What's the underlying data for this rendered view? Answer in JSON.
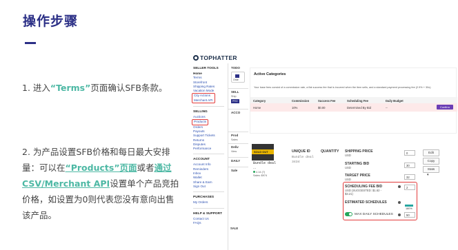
{
  "slide": {
    "title": "操作步骤",
    "step1": {
      "pre": "1. 进入",
      "highlight": "“Terms”",
      "post": "页面确认SFB条款。"
    },
    "step2": {
      "pre": "2.  为产品设置SFB价格和每日最大安排量：可以在",
      "highlight1": "“Products”页面",
      "mid": "或者",
      "highlight2": "通过CSV/Merchant API",
      "post": "设置单个产品竞拍价格，如设置为0则代表您没有意向出售该产品。"
    },
    "colors": {
      "title": "#2b2f86",
      "accent": "#4db8a4",
      "annotation": "#e23a3a"
    }
  },
  "screenshot": {
    "logo": "TOPHATTER",
    "sidebar": {
      "seller_tools_head": "SELLER TOOLS",
      "seller_tools": [
        "Home",
        "Terms",
        "Storefront",
        "Shipping Rates",
        "Vacation Mode",
        "City Actions",
        "Merchant API"
      ],
      "selling_head": "SELLING",
      "selling": [
        "Auctions",
        "Products",
        "Orders",
        "Payouts",
        "Support Tickets",
        "Returns",
        "Disputes",
        "Performance"
      ],
      "account_head": "ACCOUNT",
      "account": [
        "Account Info",
        "Reminders",
        "Inbox",
        "Wallet",
        "Share & Earn",
        "Sign Out"
      ],
      "purchases_head": "PURCHASES",
      "purchases": [
        "My Orders"
      ],
      "help_head": "HELP & SUPPORT",
      "help": [
        "Contact Us",
        "FAQs"
      ]
    },
    "todo": {
      "label": "TODO",
      "card_text": "Orde",
      "sections": [
        "SELL",
        "ACCO",
        "Prod",
        "Deliv",
        "DAILY",
        "Sale",
        "SALE"
      ],
      "small": [
        "Ship",
        "Sales",
        "View"
      ],
      "button": "PRO"
    },
    "categories": {
      "title": "Active Categories",
      "description": "Your base fees consist of a commission rate, a flat success fee that is incurred when the item sells, and a standard payment processing fee (2.9% + 30c).",
      "headers": [
        "Category",
        "Commission",
        "Success Fee",
        "Scheduling Fee",
        "Daily Budget"
      ],
      "row": [
        "Home",
        "10%",
        "$0.00",
        "Determined By Bid",
        "--"
      ],
      "confirm": "Confirm"
    },
    "product": {
      "sold_out": "SOLD OUT",
      "name": "Bundle deal",
      "dots": "...",
      "meta1": "4.14 (7)",
      "meta2": "Sales: $974",
      "uid_head": "UNIQUE ID",
      "qty_head": "QUANTITY",
      "uid_val": "Bundle deal",
      "uid_num": "3434"
    },
    "pricing": {
      "shipping_price": "SHIPPING PRICE",
      "shipping_sub": "USD",
      "shipping_val": "0",
      "starting_bid": "STARTING BID",
      "starting_sub": "USD",
      "starting_val": "30",
      "target_price": "TARGET PRICE",
      "target_sub": "USD",
      "target_val": "32",
      "fee_bid": "SCHEDULING FEE BID",
      "fee_sub": "USD (SUGGESTED: $1.62 - $3.21)",
      "fee_val": "2",
      "estimated": "ESTIMATED SCHEDULES",
      "estimated_pct": "180%",
      "estimated_progress": 1.0,
      "max_daily": "MAX DAILY SCHEDULES",
      "max_val": "50"
    },
    "side_buttons": [
      "Edit",
      "Copy",
      "Stats"
    ]
  }
}
